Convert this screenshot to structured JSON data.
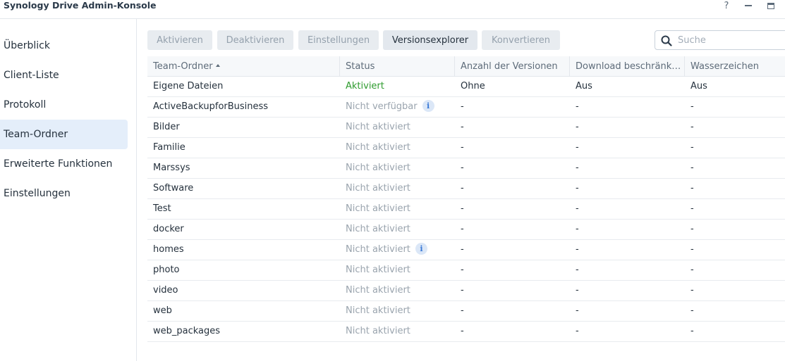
{
  "window": {
    "title": "Synology Drive Admin-Konsole",
    "help_glyph": "?"
  },
  "sidebar": {
    "items": [
      {
        "label": "Überblick"
      },
      {
        "label": "Client-Liste"
      },
      {
        "label": "Protokoll"
      },
      {
        "label": "Team-Ordner",
        "active": true
      },
      {
        "label": "Erweiterte Funktionen"
      },
      {
        "label": "Einstellungen"
      }
    ]
  },
  "toolbar": {
    "activate": "Aktivieren",
    "deactivate": "Deaktivieren",
    "settings": "Einstellungen",
    "version_explorer": "Versionsexplorer",
    "convert": "Konvertieren"
  },
  "search": {
    "placeholder": "Suche",
    "value": ""
  },
  "table": {
    "columns": [
      "Team-Ordner",
      "Status",
      "Anzahl der Versionen",
      "Download beschränk…",
      "Wasserzeichen"
    ],
    "rows": [
      {
        "name": "Eigene Dateien",
        "status": "Aktiviert",
        "versions": "Ohne",
        "download": "Aus",
        "watermark": "Aus"
      },
      {
        "name": "ActiveBackupforBusiness",
        "status": "Nicht verfügbar",
        "info": true,
        "versions": "-",
        "download": "-",
        "watermark": "-"
      },
      {
        "name": "Bilder",
        "status": "Nicht aktiviert",
        "versions": "-",
        "download": "-",
        "watermark": "-"
      },
      {
        "name": "Familie",
        "status": "Nicht aktiviert",
        "versions": "-",
        "download": "-",
        "watermark": "-"
      },
      {
        "name": "Marssys",
        "status": "Nicht aktiviert",
        "versions": "-",
        "download": "-",
        "watermark": "-"
      },
      {
        "name": "Software",
        "status": "Nicht aktiviert",
        "versions": "-",
        "download": "-",
        "watermark": "-"
      },
      {
        "name": "Test",
        "status": "Nicht aktiviert",
        "versions": "-",
        "download": "-",
        "watermark": "-"
      },
      {
        "name": "docker",
        "status": "Nicht aktiviert",
        "versions": "-",
        "download": "-",
        "watermark": "-"
      },
      {
        "name": "homes",
        "status": "Nicht aktiviert",
        "info": true,
        "versions": "-",
        "download": "-",
        "watermark": "-"
      },
      {
        "name": "photo",
        "status": "Nicht aktiviert",
        "versions": "-",
        "download": "-",
        "watermark": "-"
      },
      {
        "name": "video",
        "status": "Nicht aktiviert",
        "versions": "-",
        "download": "-",
        "watermark": "-"
      },
      {
        "name": "web",
        "status": "Nicht aktiviert",
        "versions": "-",
        "download": "-",
        "watermark": "-"
      },
      {
        "name": "web_packages",
        "status": "Nicht aktiviert",
        "versions": "-",
        "download": "-",
        "watermark": "-"
      }
    ]
  },
  "colors": {
    "accent": "#e4eefa",
    "status_active": "#2e9b2e",
    "status_inactive": "#9aa4ae",
    "info_icon": "#3a79d6"
  },
  "icons": {
    "search": "search-icon",
    "info": "info-icon",
    "sort": "sort-ascending-icon"
  }
}
